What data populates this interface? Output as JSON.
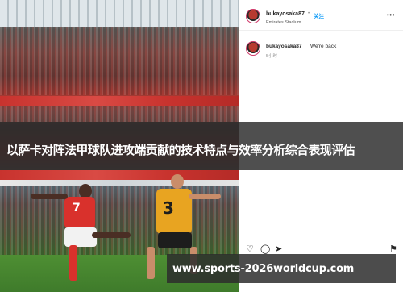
{
  "post": {
    "username": "bukayosaka87",
    "verified_mark": "✓",
    "separator": "•",
    "follow_label": "关注",
    "location": "Emirates Stadium",
    "more_icon": "more-horizontal-icon",
    "caption_username": "bukayosaka87",
    "caption_text": "We're back",
    "time_ago": "5小时",
    "actions": [
      "heart-icon",
      "comment-icon",
      "share-icon",
      "bookmark-icon"
    ]
  },
  "photo": {
    "description_numbers": {
      "yellow_player_number": "3",
      "red_player_number": "7"
    }
  },
  "overlay": {
    "title": "以萨卡对阵法甲球队进攻端贡献的技术特点与效率分析综合表现评估",
    "url": "www.sports-2026worldcup.com"
  },
  "colors": {
    "title_band": "#282828",
    "follow_blue": "#0095f6",
    "arsenal_red": "#d9312c",
    "wolves_gold": "#e8a421"
  }
}
